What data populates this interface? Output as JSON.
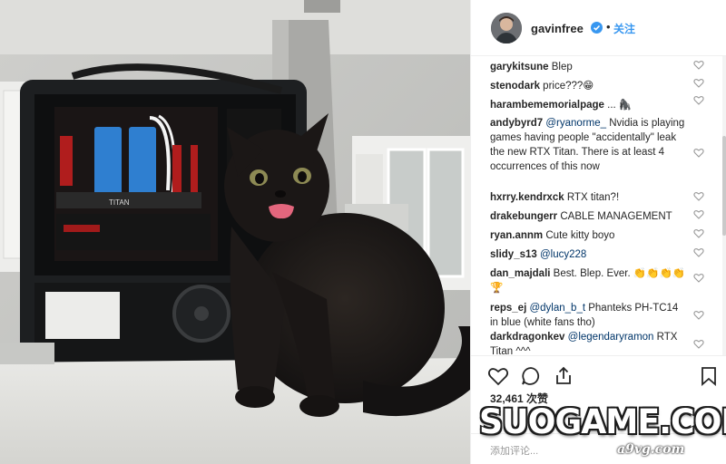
{
  "post": {
    "username": "gavinfree",
    "follow_label": "关注",
    "separator": "•"
  },
  "comments": [
    {
      "user": "garykitsune",
      "parts": [
        {
          "t": "text",
          "v": "Blep"
        }
      ]
    },
    {
      "user": "stenodark",
      "parts": [
        {
          "t": "text",
          "v": "price???😁"
        }
      ]
    },
    {
      "user": "harambememorialpage",
      "parts": [
        {
          "t": "text",
          "v": "... 🦍"
        }
      ]
    },
    {
      "user": "andybyrd7",
      "parts": [
        {
          "t": "mention",
          "v": "@ryanorme_"
        },
        {
          "t": "text",
          "v": " Nvidia is playing games having people \"accidentally\" leak the new RTX Titan. There is at least 4 occurrences of this now"
        }
      ]
    },
    {
      "user": "hxrry.kendrxck",
      "parts": [
        {
          "t": "text",
          "v": "RTX titan?!"
        }
      ]
    },
    {
      "user": "drakebungerr",
      "parts": [
        {
          "t": "text",
          "v": "CABLE MANAGEMENT"
        }
      ]
    },
    {
      "user": "ryan.annm",
      "parts": [
        {
          "t": "text",
          "v": "Cute kitty boyo"
        }
      ]
    },
    {
      "user": "slidy_s13",
      "parts": [
        {
          "t": "mention",
          "v": "@lucy228"
        }
      ]
    },
    {
      "user": "dan_majdali",
      "parts": [
        {
          "t": "text",
          "v": "Best. Blep. Ever. 👏👏👏👏🏆"
        }
      ]
    },
    {
      "user": "reps_ej",
      "parts": [
        {
          "t": "mention",
          "v": "@dylan_b_t"
        },
        {
          "t": "text",
          "v": " Phanteks PH-TC14 in blue (white fans tho)"
        }
      ]
    },
    {
      "user": "darkdragonkev",
      "parts": [
        {
          "t": "mention",
          "v": "@legendaryramon"
        },
        {
          "t": "text",
          "v": " RTX Titan ^^^"
        }
      ]
    }
  ],
  "stats": {
    "likes_text": "32,461 次赞"
  },
  "add_comment": {
    "placeholder": "添加评论..."
  },
  "photo": {
    "gpu_label": "TITAN"
  },
  "watermark": {
    "main": "SUOGAME.COM",
    "sub": "a9vg.com"
  },
  "icons": {
    "heart": "heart-icon",
    "comment": "comment-icon",
    "share": "share-icon",
    "bookmark": "bookmark-icon",
    "verified": "verified-badge-icon"
  },
  "colors": {
    "link": "#003569",
    "follow": "#3897f0",
    "verified": "#3897f0"
  }
}
